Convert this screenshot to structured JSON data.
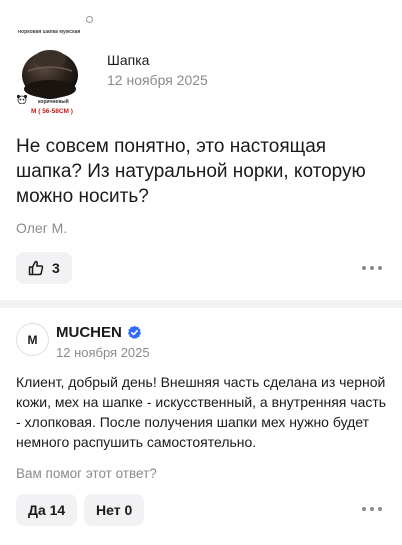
{
  "product": {
    "image_caption": "норковая шапка мужская",
    "image_color_label": "коричневый",
    "image_size_label": "M ( 56-58CM )",
    "name": "Шапка",
    "date": "12 ноября 2025"
  },
  "question": {
    "text": "Не совсем понятно, это настоящая шапка? Из натуральной норки, которую можно носить?",
    "author": "Олег М.",
    "likes": "3"
  },
  "answer": {
    "avatar_initial": "M",
    "seller_name": "MUCHEN",
    "date": "12 ноября 2025",
    "text": "Клиент, добрый день! Внешняя часть сделана из черной кожи, мех на шапке - искусственный, а внутренняя часть - хлопковая. После получения шапки мех нужно будет немного распушить самостоятельно.",
    "helpful_prompt": "Вам помог этот ответ?",
    "yes_label": "Да 14",
    "no_label": "Нет 0"
  },
  "icons": {
    "like": "thumbs-up-icon",
    "more": "more-dots-icon",
    "verified": "verified-check-icon"
  },
  "colors": {
    "accent_blue": "#2f6bff",
    "button_bg": "#f2f2f5",
    "muted_text": "#8a8a8f",
    "size_red": "#c21a1a"
  }
}
